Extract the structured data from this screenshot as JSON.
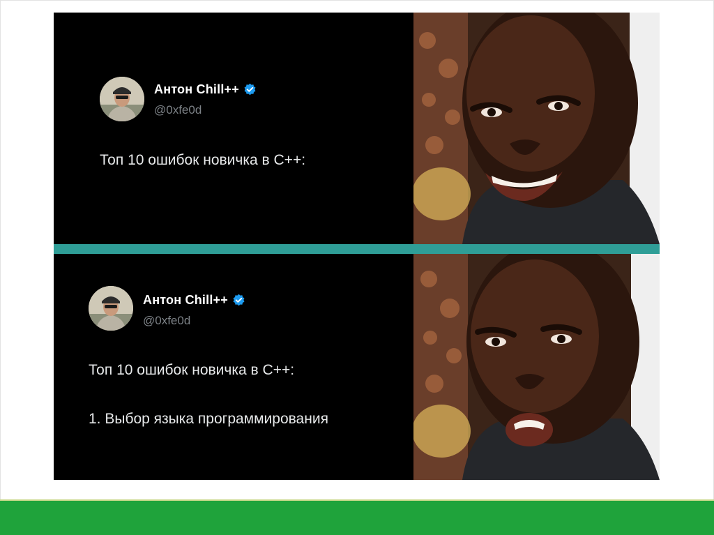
{
  "slide": {
    "footer_color": "#1fa33b",
    "divider_color": "#2f9e97",
    "background_color": "#ffffff"
  },
  "panels": [
    {
      "author_name": "Антон Chill++",
      "handle": "@0xfe0d",
      "text_lines": [
        "Топ 10 ошибок новичка в C++:"
      ],
      "verified_icon": "verified-badge-icon",
      "reaction": "smiling"
    },
    {
      "author_name": "Антон Chill++",
      "handle": "@0xfe0d",
      "text_lines": [
        "Топ 10 ошибок новичка в C++:",
        "1. Выбор языка программирования"
      ],
      "verified_icon": "verified-badge-icon",
      "reaction": "disappointed"
    }
  ]
}
